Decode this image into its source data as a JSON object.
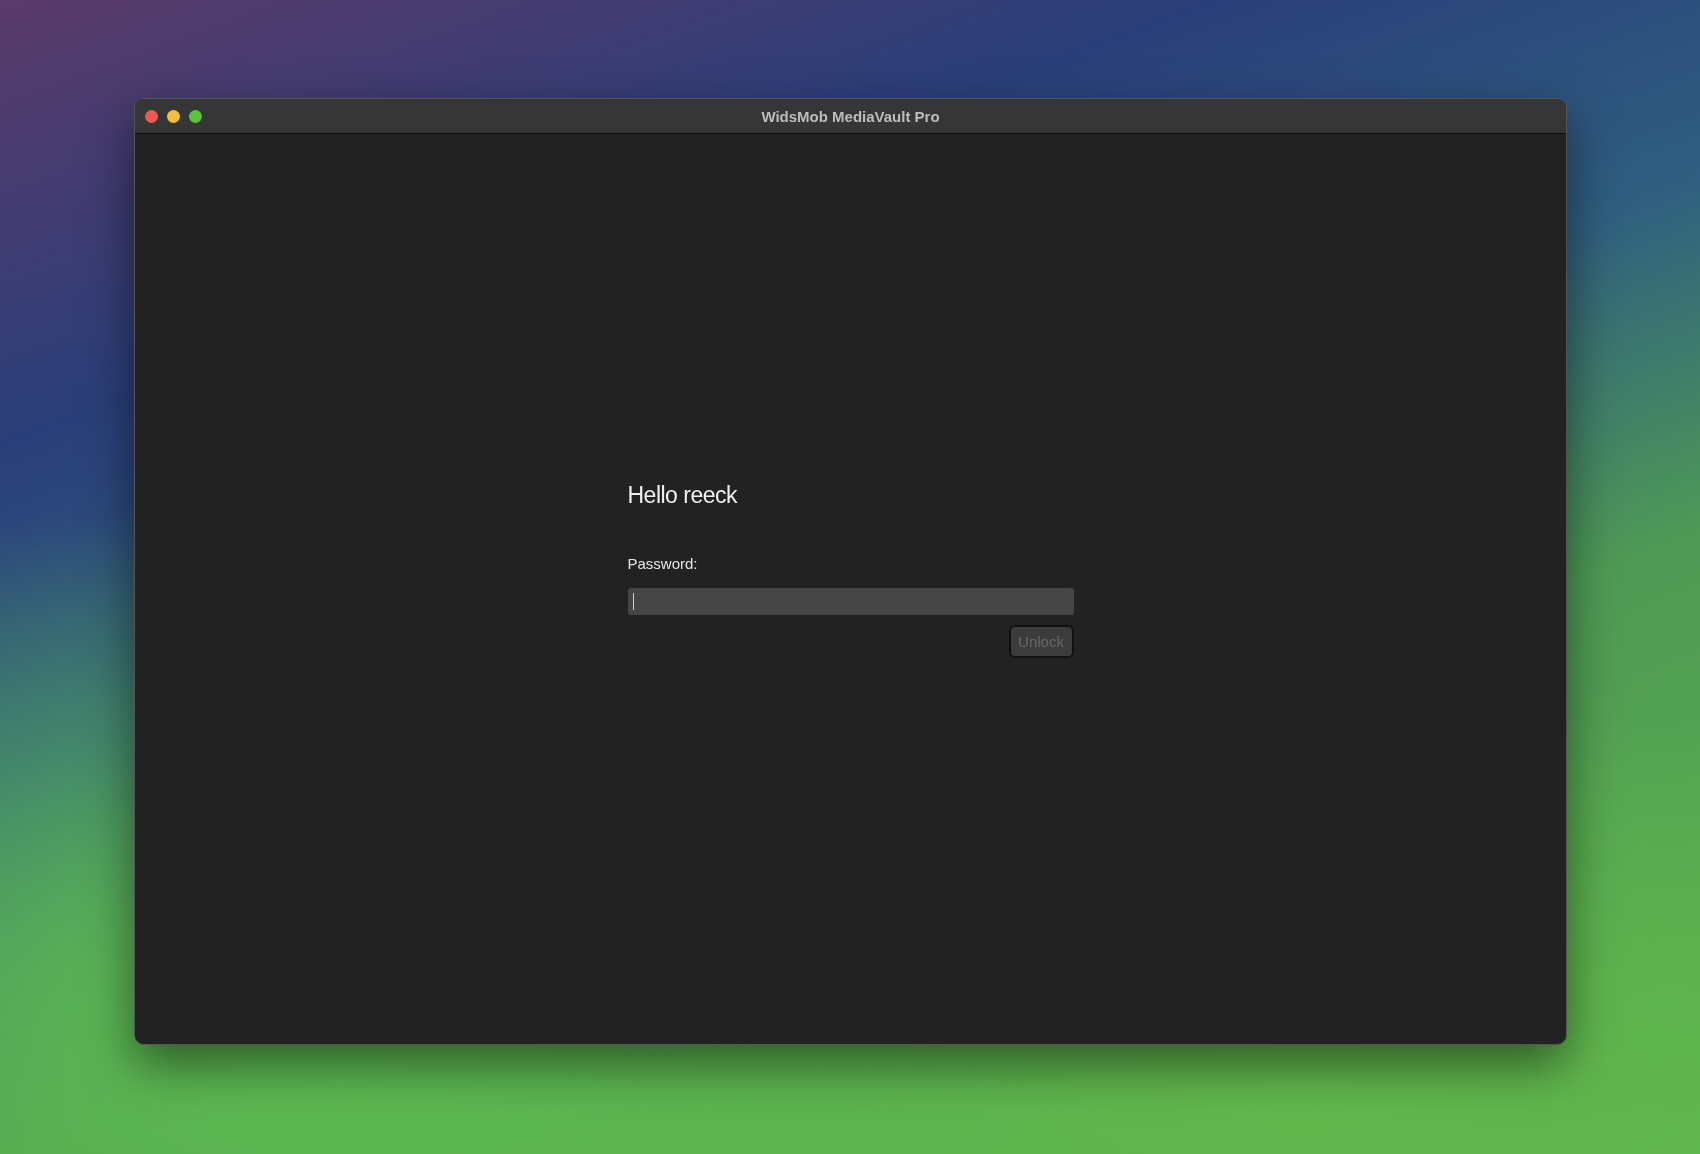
{
  "window": {
    "title": "WidsMob MediaVault Pro"
  },
  "greeting": "Hello reeck",
  "password": {
    "label": "Password:",
    "focused": true
  },
  "unlock_button": {
    "label": "Unlock",
    "disabled": true
  }
}
